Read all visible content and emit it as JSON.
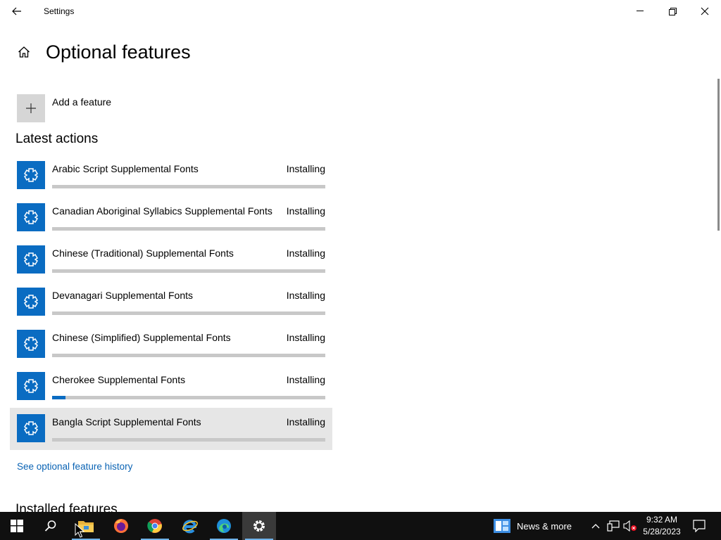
{
  "window": {
    "title": "Settings",
    "back_icon": "arrow-left-icon",
    "minimize_icon": "minimize-icon",
    "restore_icon": "restore-icon",
    "close_icon": "close-icon"
  },
  "page": {
    "title": "Optional features",
    "home_icon": "home-icon"
  },
  "add_feature": {
    "label": "Add a feature",
    "icon": "plus-icon"
  },
  "latest_actions": {
    "title": "Latest actions",
    "items": [
      {
        "name": "Arabic Script Supplemental Fonts",
        "status": "Installing",
        "progress": 0
      },
      {
        "name": "Canadian Aboriginal Syllabics Supplemental Fonts",
        "status": "Installing",
        "progress": 0
      },
      {
        "name": "Chinese (Traditional) Supplemental Fonts",
        "status": "Installing",
        "progress": 0
      },
      {
        "name": "Devanagari Supplemental Fonts",
        "status": "Installing",
        "progress": 0
      },
      {
        "name": "Chinese (Simplified) Supplemental Fonts",
        "status": "Installing",
        "progress": 0
      },
      {
        "name": "Cherokee Supplemental Fonts",
        "status": "Installing",
        "progress": 0.05
      },
      {
        "name": "Bangla Script Supplemental Fonts",
        "status": "Installing",
        "progress": 0
      }
    ]
  },
  "history_link": "See optional feature history",
  "installed_title": "Installed features",
  "taskbar": {
    "news_label": "News & more",
    "time": "9:32 AM",
    "date": "5/28/2023",
    "accent_color": "#0a6cc2"
  }
}
